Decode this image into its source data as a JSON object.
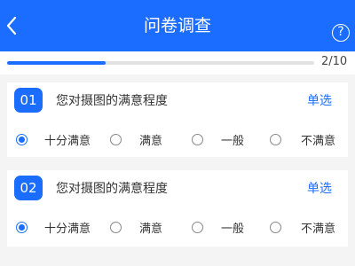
{
  "header": {
    "title": "问卷调查",
    "help_symbol": "?"
  },
  "progress": {
    "text": "2/10",
    "fraction": 0.32
  },
  "questions": [
    {
      "number": "01",
      "title": "您对摄图的满意程度",
      "type": "单选",
      "options": [
        "十分满意",
        "满意",
        "一般",
        "不满意"
      ],
      "selected_index": 0
    },
    {
      "number": "02",
      "title": "您对摄图的满意程度",
      "type": "单选",
      "options": [
        "十分满意",
        "满意",
        "一般",
        "不满意"
      ],
      "selected_index": 0
    }
  ],
  "colors": {
    "accent": "#1a6dff",
    "background": "#f4f4f4",
    "progress_track": "#e2e2e2"
  },
  "icons": {
    "back": "chevron-left-icon",
    "help": "help-circle-icon",
    "radio": "radio-icon"
  }
}
